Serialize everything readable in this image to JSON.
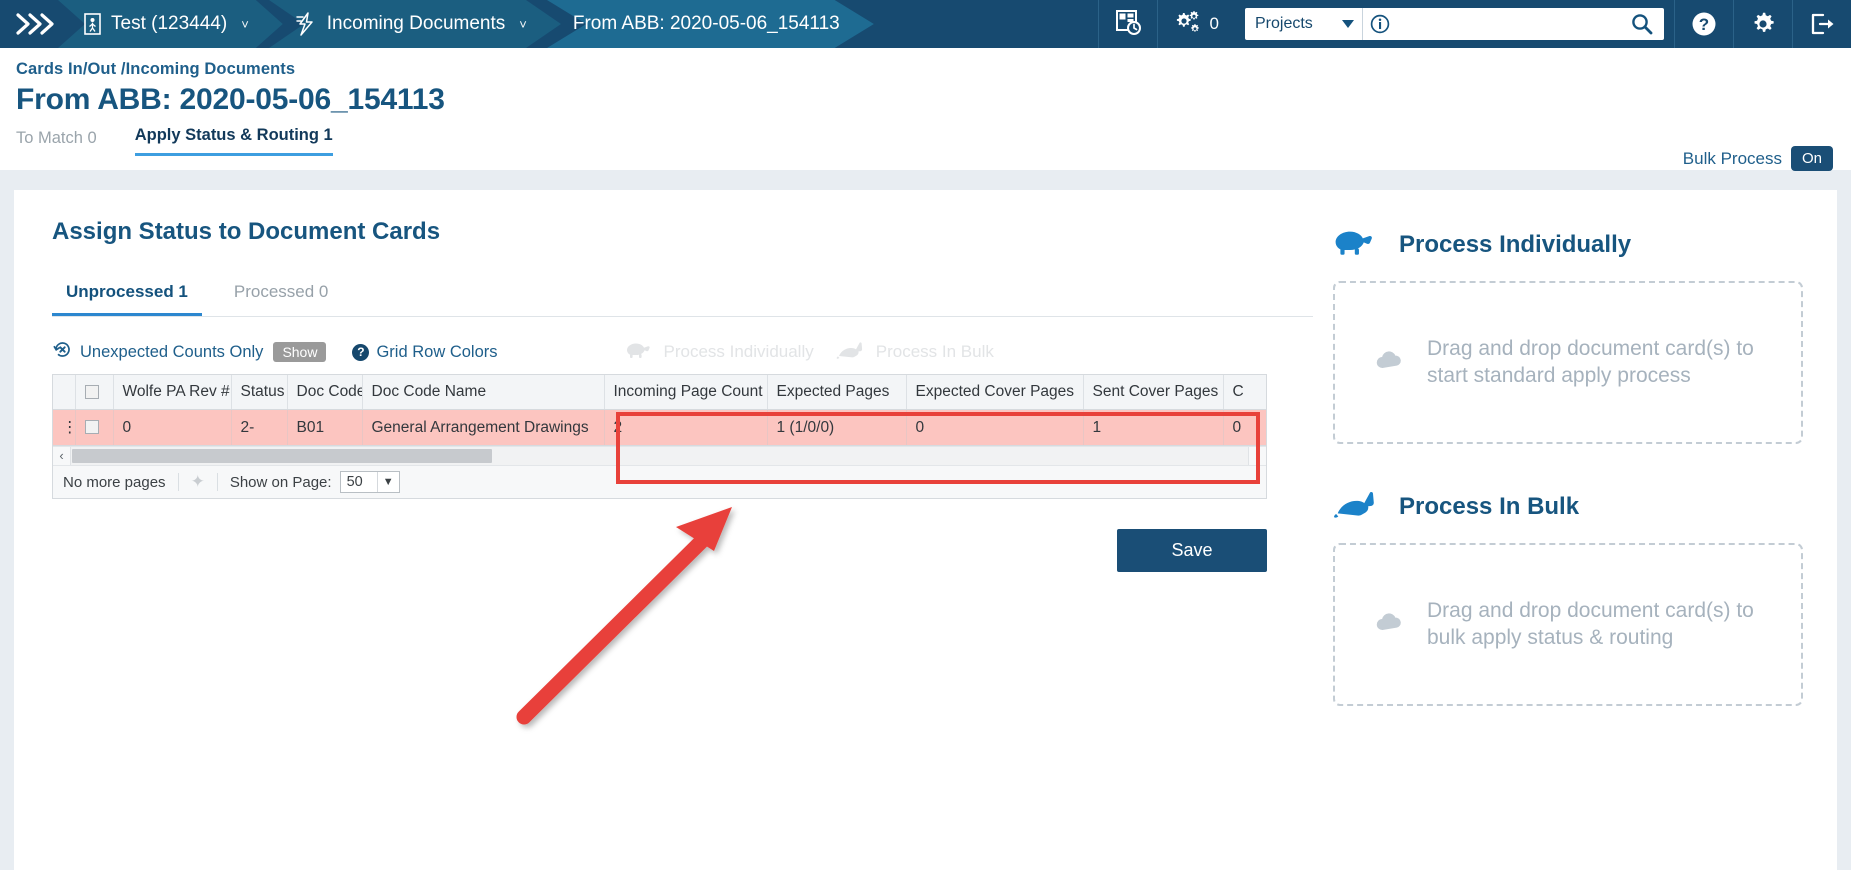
{
  "topbar": {
    "logo_icon": "chevrons-logo-icon",
    "crumbs": [
      {
        "label": "Test (123444)",
        "icon": "person-card-icon",
        "caret": "˅"
      },
      {
        "label": "Incoming Documents",
        "icon": "lightning-bolt-icon",
        "caret": "˅"
      },
      {
        "label": "From ABB: 2020-05-06_154113",
        "icon": "",
        "caret": ""
      }
    ],
    "recent_icon": "recent-items-clock-icon",
    "gears_icon": "gears-icon",
    "gears_count": "0",
    "project_select": "Projects",
    "info_icon": "info-circle-icon",
    "search_placeholder": "",
    "search_value": "",
    "search_icon": "search-icon",
    "help_icon": "help-circle-icon",
    "settings_icon": "gear-icon",
    "logout_icon": "logout-icon"
  },
  "page": {
    "breadcrumb": "Cards In/Out /Incoming Documents",
    "title": "From ABB: 2020-05-06_154113",
    "tabs": [
      {
        "label": "To Match 0",
        "active": false
      },
      {
        "label": "Apply Status & Routing 1",
        "active": true
      }
    ],
    "bulk_process_label": "Bulk Process",
    "bulk_process_state": "On"
  },
  "main": {
    "title": "Assign Status to Document Cards",
    "tabs": [
      {
        "label": "Unprocessed 1",
        "active": true
      },
      {
        "label": "Processed 0",
        "active": false
      }
    ],
    "toolbar": {
      "unexpected_icon": "refresh-x-icon",
      "unexpected_label": "Unexpected Counts Only",
      "show_badge": "Show",
      "help_icon": "help-circle-icon",
      "grid_row_colors_label": "Grid Row Colors",
      "process_individually_label": "Process Individually",
      "process_individually_icon": "turtle-icon",
      "process_in_bulk_label": "Process In Bulk",
      "process_in_bulk_icon": "rabbit-icon"
    },
    "grid": {
      "columns": [
        {
          "key": "handle",
          "label": ""
        },
        {
          "key": "check",
          "label": ""
        },
        {
          "key": "rev",
          "label": "Wolfe PA Rev #"
        },
        {
          "key": "status",
          "label": "Status"
        },
        {
          "key": "doccode",
          "label": "Doc Code"
        },
        {
          "key": "doccodename",
          "label": "Doc Code Name"
        },
        {
          "key": "incoming",
          "label": "Incoming Page Count"
        },
        {
          "key": "expected",
          "label": "Expected Pages"
        },
        {
          "key": "expcover",
          "label": "Expected Cover Pages"
        },
        {
          "key": "sentcover",
          "label": "Sent Cover Pages"
        },
        {
          "key": "cut",
          "label": "C"
        }
      ],
      "rows": [
        {
          "handle": "⋮",
          "rev": "0",
          "status": "2-",
          "doccode": "B01",
          "doccodename": "General Arrangement Drawings",
          "incoming": "2",
          "expected": "1 (1/0/0)",
          "expcover": "0",
          "sentcover": "1",
          "cut": "0"
        }
      ],
      "footer": {
        "no_more_pages": "No more pages",
        "refresh_icon": "loading-spinner-icon",
        "show_on_page_label": "Show on Page:",
        "show_on_page_value": "50"
      }
    },
    "save_label": "Save"
  },
  "side": {
    "sections": [
      {
        "icon": "turtle-icon",
        "title": "Process Individually",
        "drop_icon": "cloud-upload-icon",
        "drop_text": "Drag and drop document card(s) to start standard apply process"
      },
      {
        "icon": "rabbit-icon",
        "title": "Process In Bulk",
        "drop_icon": "cloud-upload-icon",
        "drop_text": "Drag and drop document card(s) to bulk apply status & routing"
      }
    ]
  },
  "annotation": {
    "highlight_color": "#e8413a",
    "arrow_color": "#e8413a"
  }
}
